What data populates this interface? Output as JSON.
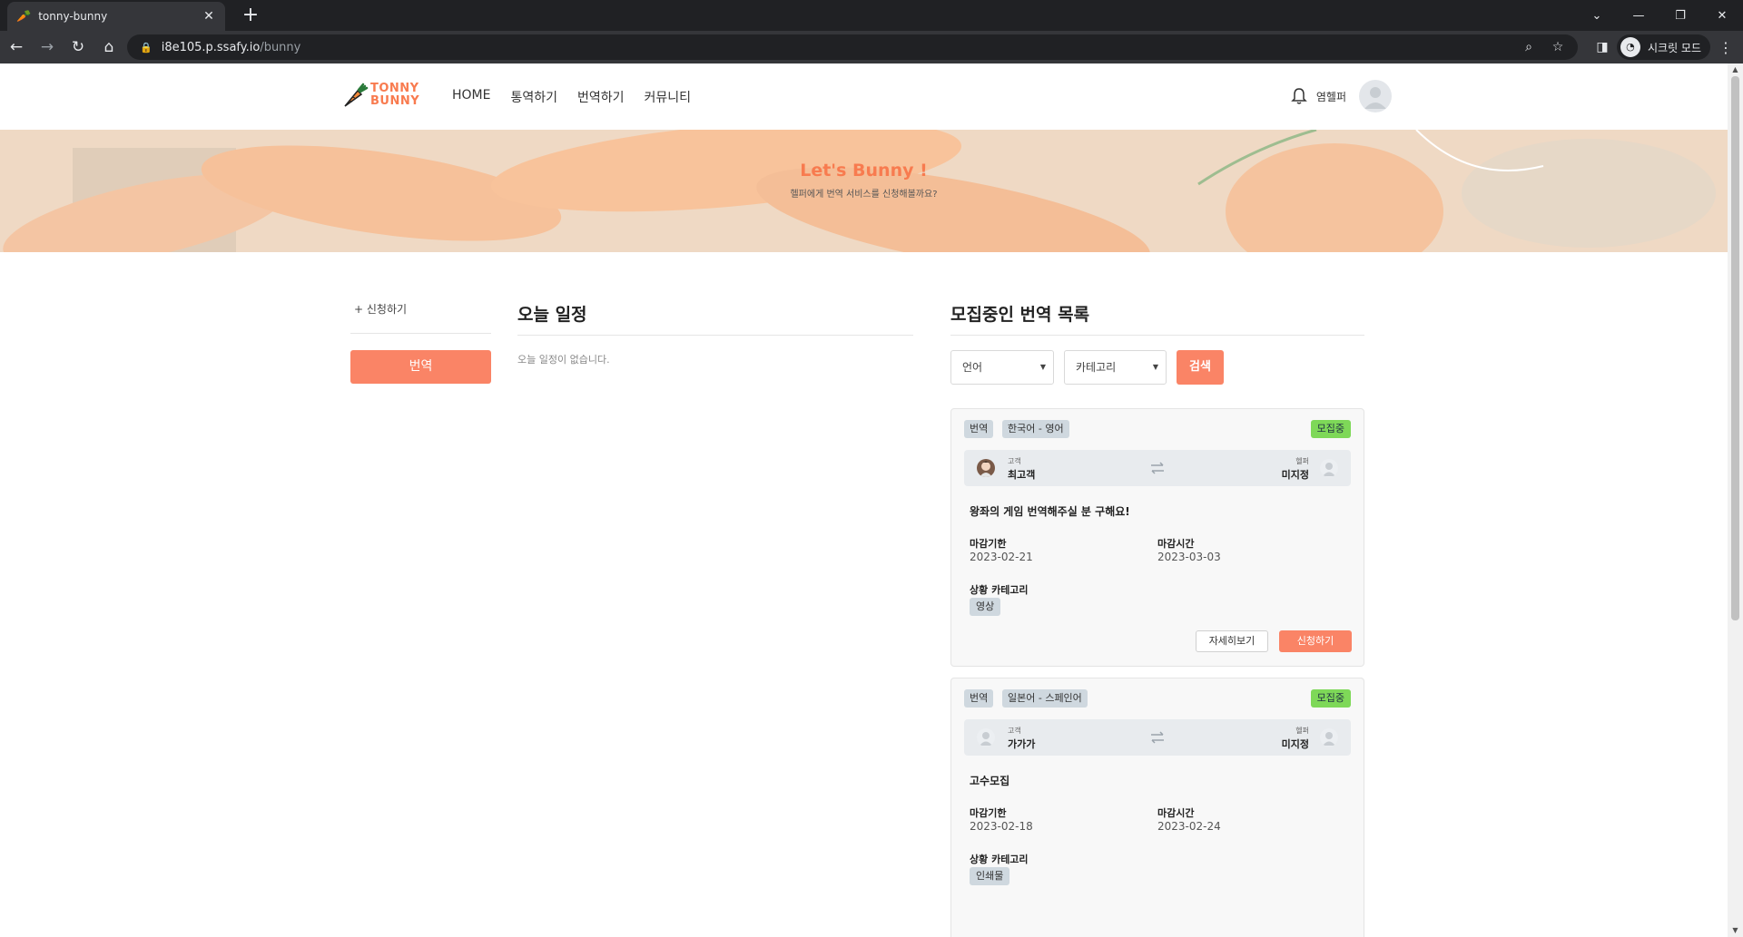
{
  "browser": {
    "tab_title": "tonny-bunny",
    "url_host": "i8e105.p.ssafy.io",
    "url_path": "/bunny",
    "profile_label": "시크릿 모드"
  },
  "header": {
    "logo_line1": "TONNY",
    "logo_line2": "BUNNY",
    "nav": [
      "HOME",
      "통역하기",
      "번역하기",
      "커뮤니티"
    ],
    "user_name": "염헬퍼"
  },
  "hero": {
    "title": "Let's Bunny !",
    "subtitle": "헬퍼에게 번역 서비스를 신청해볼까요?"
  },
  "sidebar": {
    "add_label": "+ 신청하기",
    "active_button": "번역"
  },
  "schedule": {
    "title": "오늘 일정",
    "empty_text": "오늘 일정이 없습니다."
  },
  "list": {
    "title": "모집중인 번역 목록",
    "filter_language": "언어",
    "filter_category": "카테고리",
    "search_label": "검색",
    "cards": [
      {
        "type_tag": "번역",
        "lang_tag": "한국어 - 영어",
        "status": "모집중",
        "client_role": "고객",
        "client_name": "최고객",
        "helper_role": "헬퍼",
        "helper_name": "미지정",
        "title": "왕좌의 게임 번역해주실 분 구해요!",
        "deadline_label": "마감기한",
        "deadline": "2023-02-21",
        "closing_label": "마감시간",
        "closing": "2023-03-03",
        "category_label": "상황 카테고리",
        "category": "영상",
        "detail_label": "자세히보기",
        "apply_label": "신청하기"
      },
      {
        "type_tag": "번역",
        "lang_tag": "일본어 - 스페인어",
        "status": "모집중",
        "client_role": "고객",
        "client_name": "가가가",
        "helper_role": "헬퍼",
        "helper_name": "미지정",
        "title": "고수모집",
        "deadline_label": "마감기한",
        "deadline": "2023-02-18",
        "closing_label": "마감시간",
        "closing": "2023-02-24",
        "category_label": "상황 카테고리",
        "category": "인쇄물"
      }
    ]
  },
  "colors": {
    "accent": "#fa8466",
    "status_green": "#7ed858",
    "tag_bg": "#cfd8df"
  }
}
